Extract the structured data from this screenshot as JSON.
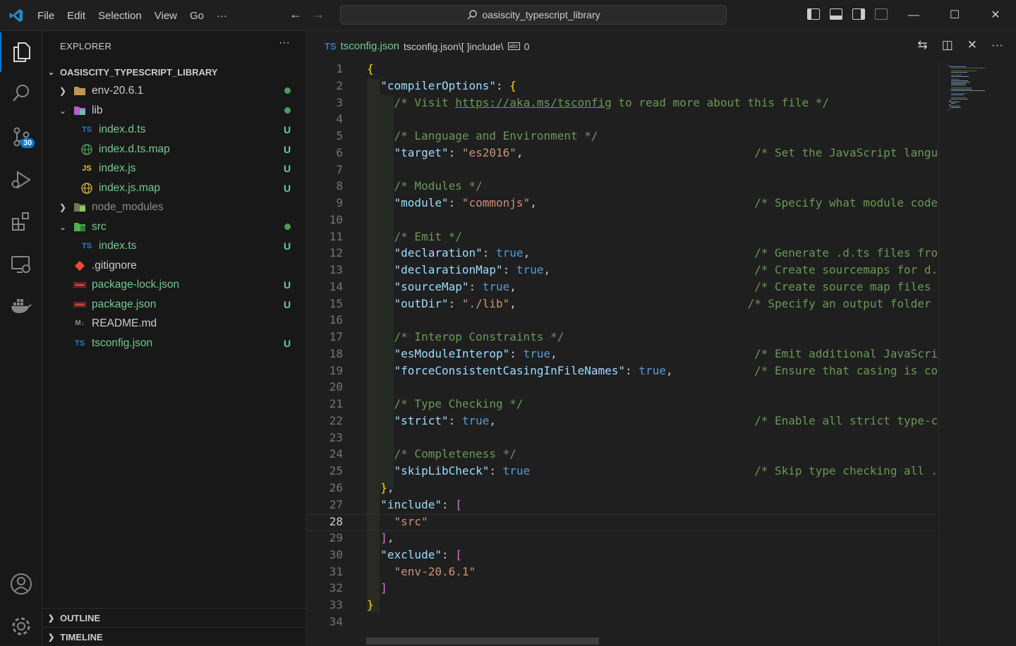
{
  "menu": [
    "File",
    "Edit",
    "Selection",
    "View",
    "Go",
    "···"
  ],
  "command_center": "oasiscity_typescript_library",
  "window_controls": [
    "—",
    "☐",
    "✕"
  ],
  "activity_badge": "30",
  "sidebar": {
    "title": "EXPLORER",
    "more": "···",
    "project": "OASISCITY_TYPESCRIPT_LIBRARY",
    "items": [
      {
        "name": "env-20.6.1",
        "status": "",
        "depth": 0
      },
      {
        "name": "lib",
        "status": "",
        "depth": 0
      },
      {
        "name": "index.d.ts",
        "status": "U",
        "depth": 1,
        "icon": "TS"
      },
      {
        "name": "index.d.ts.map",
        "status": "U",
        "depth": 1
      },
      {
        "name": "index.js",
        "status": "U",
        "depth": 1,
        "icon": "JS"
      },
      {
        "name": "index.js.map",
        "status": "U",
        "depth": 1
      },
      {
        "name": "node_modules",
        "status": "",
        "depth": 0
      },
      {
        "name": "src",
        "status": "",
        "depth": 0
      },
      {
        "name": "index.ts",
        "status": "U",
        "depth": 1,
        "icon": "TS"
      },
      {
        "name": ".gitignore",
        "status": "",
        "depth": 0
      },
      {
        "name": "package-lock.json",
        "status": "U",
        "depth": 0
      },
      {
        "name": "package.json",
        "status": "U",
        "depth": 0
      },
      {
        "name": "README.md",
        "status": "",
        "depth": 0,
        "icon": "M↓"
      },
      {
        "name": "tsconfig.json",
        "status": "U",
        "depth": 0,
        "icon": "TS"
      }
    ],
    "panels": [
      "OUTLINE",
      "TIMELINE"
    ]
  },
  "editor": {
    "tab_file": "tsconfig.json",
    "breadcrumb": "tsconfig.json\\[ ]include\\",
    "breadcrumb_index": "0",
    "current_line": 28,
    "lines": [
      "{",
      "  \"compilerOptions\": {",
      "    /* Visit https://aka.ms/tsconfig to read more about this file */",
      "",
      "    /* Language and Environment */",
      "    \"target\": \"es2016\",                                  /* Set the JavaScript langu",
      "",
      "    /* Modules */",
      "    \"module\": \"commonjs\",                                /* Specify what module code",
      "",
      "    /* Emit */",
      "    \"declaration\": true,                                 /* Generate .d.ts files fro",
      "    \"declarationMap\": true,                              /* Create sourcemaps for d.",
      "    \"sourceMap\": true,                                   /* Create source map files ",
      "    \"outDir\": \"./lib\",                                  /* Specify an output folder",
      "",
      "    /* Interop Constraints */",
      "    \"esModuleInterop\": true,                             /* Emit additional JavaScri",
      "    \"forceConsistentCasingInFileNames\": true,            /* Ensure that casing is co",
      "",
      "    /* Type Checking */",
      "    \"strict\": true,                                      /* Enable all strict type-c",
      "",
      "    /* Completeness */",
      "    \"skipLibCheck\": true                                 /* Skip type checking all .",
      "  },",
      "  \"include\": [",
      "    \"src\"",
      "  ],",
      "  \"exclude\": [",
      "    \"env-20.6.1\"",
      "  ]",
      "}",
      ""
    ]
  },
  "colors": {
    "accent": "#0078d4",
    "untracked": "#73c991",
    "key": "#9cdcfe",
    "string": "#ce9178",
    "keyword": "#569cd6",
    "comment": "#6a9955"
  }
}
